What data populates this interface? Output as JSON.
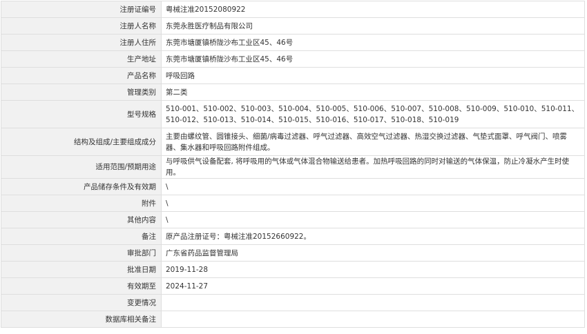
{
  "rows": [
    {
      "label": "注册证编号",
      "value": "粤械注准20152080922"
    },
    {
      "label": "注册人名称",
      "value": "东莞永胜医疗制品有限公司"
    },
    {
      "label": "注册人住所",
      "value": "东莞市塘厦镇桥陇沙布工业区45、46号"
    },
    {
      "label": "生产地址",
      "value": "东莞市塘厦镇桥陇沙布工业区45、46号"
    },
    {
      "label": "产品名称",
      "value": "呼吸回路"
    },
    {
      "label": "管理类别",
      "value": "第二类"
    },
    {
      "label": "型号规格",
      "value": "510-001、510-002、510-003、510-004、510-005、510-006、510-007、510-008、510-009、510-010、510-011、510-012、510-013、510-014、510-015、510-016、510-017、510-018、510-019"
    },
    {
      "label": "结构及组成/主要组成成分",
      "value": "主要由螺纹管、圆锥接头、细菌/病毒过滤器、呼气过滤器、高效空气过滤器、热湿交换过滤器、气垫式面罩、呼气阀门、喷雾器、集水器和呼吸回路附件组成。"
    },
    {
      "label": "适用范围/预期用途",
      "value": "与呼吸供气设备配套, 将呼吸用的气体或气体混合物输送给患者。加热呼吸回路的同时对输送的气体保温，防止冷凝水产生时使用。"
    },
    {
      "label": "产品储存条件及有效期",
      "value": "\\"
    },
    {
      "label": "附件",
      "value": "\\"
    },
    {
      "label": "其他内容",
      "value": "\\"
    },
    {
      "label": "备注",
      "value": "原产品注册证号：粤械注准20152660922。"
    },
    {
      "label": "审批部门",
      "value": "广东省药品监督管理局"
    },
    {
      "label": "批准日期",
      "value": "2019-11-28"
    },
    {
      "label": "有效期至",
      "value": "2024-11-27"
    },
    {
      "label": "变更情况",
      "value": ""
    },
    {
      "label": "数据库相关备注",
      "value": ""
    }
  ]
}
